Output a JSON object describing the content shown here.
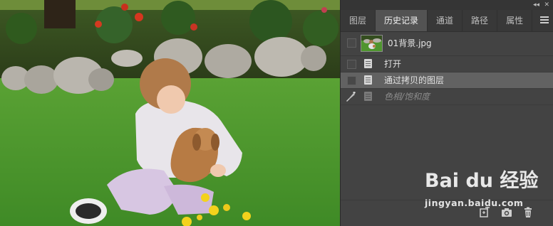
{
  "panel": {
    "collapse_glyph": "◂◂",
    "close_glyph": "✕",
    "tabs": [
      {
        "label": "图层",
        "active": false
      },
      {
        "label": "历史记录",
        "active": true
      },
      {
        "label": "通道",
        "active": false
      },
      {
        "label": "路径",
        "active": false
      },
      {
        "label": "属性",
        "active": false
      }
    ],
    "menu_icon": "panel-menu-icon"
  },
  "history": {
    "snapshot": {
      "label": "01背景.jpg",
      "icon": "snapshot-thumbnail"
    },
    "steps": [
      {
        "label": "打开",
        "icon": "document-icon",
        "state": "normal"
      },
      {
        "label": "通过拷贝的图层",
        "icon": "document-icon",
        "state": "selected"
      },
      {
        "label": "色相/饱和度",
        "icon": "document-icon",
        "state": "disabled"
      }
    ],
    "history_brush_icon": "history-brush-icon"
  },
  "bottom_bar": {
    "icons": [
      "new-document-from-state-icon",
      "camera-snapshot-icon",
      "trash-icon"
    ]
  },
  "watermark": {
    "logo_text": "Bai du 经验",
    "url": "jingyan.baidu.com"
  },
  "colors": {
    "panel_bg": "#434343",
    "tab_active_bg": "#535353",
    "selected_row": "#626262",
    "grass": "#4e9a2f"
  }
}
